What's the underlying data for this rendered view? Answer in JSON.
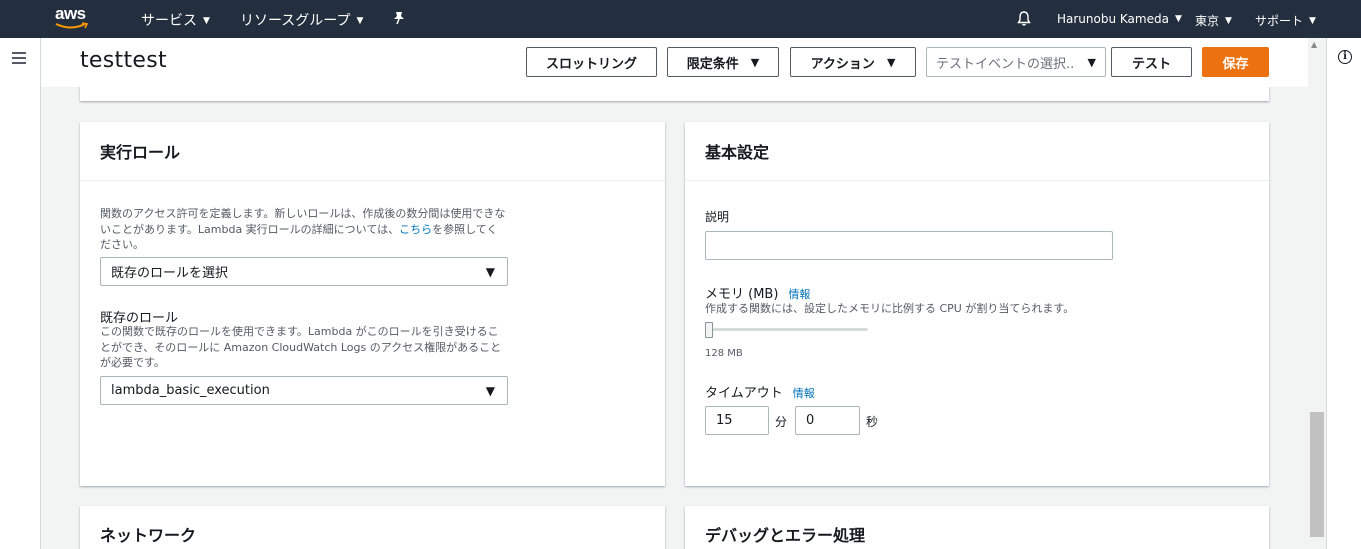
{
  "topnav": {
    "logo": "aws",
    "services": "サービス",
    "resource_groups": "リソースグループ",
    "user": "Harunobu Kameda",
    "region": "東京",
    "support": "サポート"
  },
  "header": {
    "function_name": "testtest",
    "throttle_button": "スロットリング",
    "qualifier_button": "限定条件",
    "actions_button": "アクション",
    "test_event_placeholder": "テストイベントの選択..",
    "test_button": "テスト",
    "save_button": "保存"
  },
  "execution_role": {
    "title": "実行ロール",
    "description_before_link": "関数のアクセス許可を定義します。新しいロールは、作成後の数分間は使用できないことがあります。Lambda 実行ロールの詳細については、",
    "description_link": "こちら",
    "description_after_link": "を参照してください。",
    "role_mode_value": "既存のロールを選択",
    "existing_role_label": "既存のロール",
    "existing_role_description": "この関数で既存のロールを使用できます。Lambda がこのロールを引き受けることができ、そのロールに Amazon CloudWatch Logs のアクセス権限があることが必要です。",
    "existing_role_value": "lambda_basic_execution"
  },
  "basic_settings": {
    "title": "基本設定",
    "description_label": "説明",
    "description_value": "",
    "memory_label": "メモリ (MB)",
    "memory_info": "情報",
    "memory_description": "作成する関数には、設定したメモリに比例する CPU が割り当てられます。",
    "memory_value": "128 MB",
    "memory_slider_fraction": 0.0,
    "timeout_label": "タイムアウト",
    "timeout_info": "情報",
    "timeout_minutes": "15",
    "timeout_minutes_unit": "分",
    "timeout_seconds": "0",
    "timeout_seconds_unit": "秒"
  },
  "network": {
    "title": "ネットワーク"
  },
  "debug": {
    "title": "デバッグとエラー処理"
  },
  "colors": {
    "nav_bg": "#232f3e",
    "primary": "#ec7211",
    "link": "#0073bb"
  }
}
